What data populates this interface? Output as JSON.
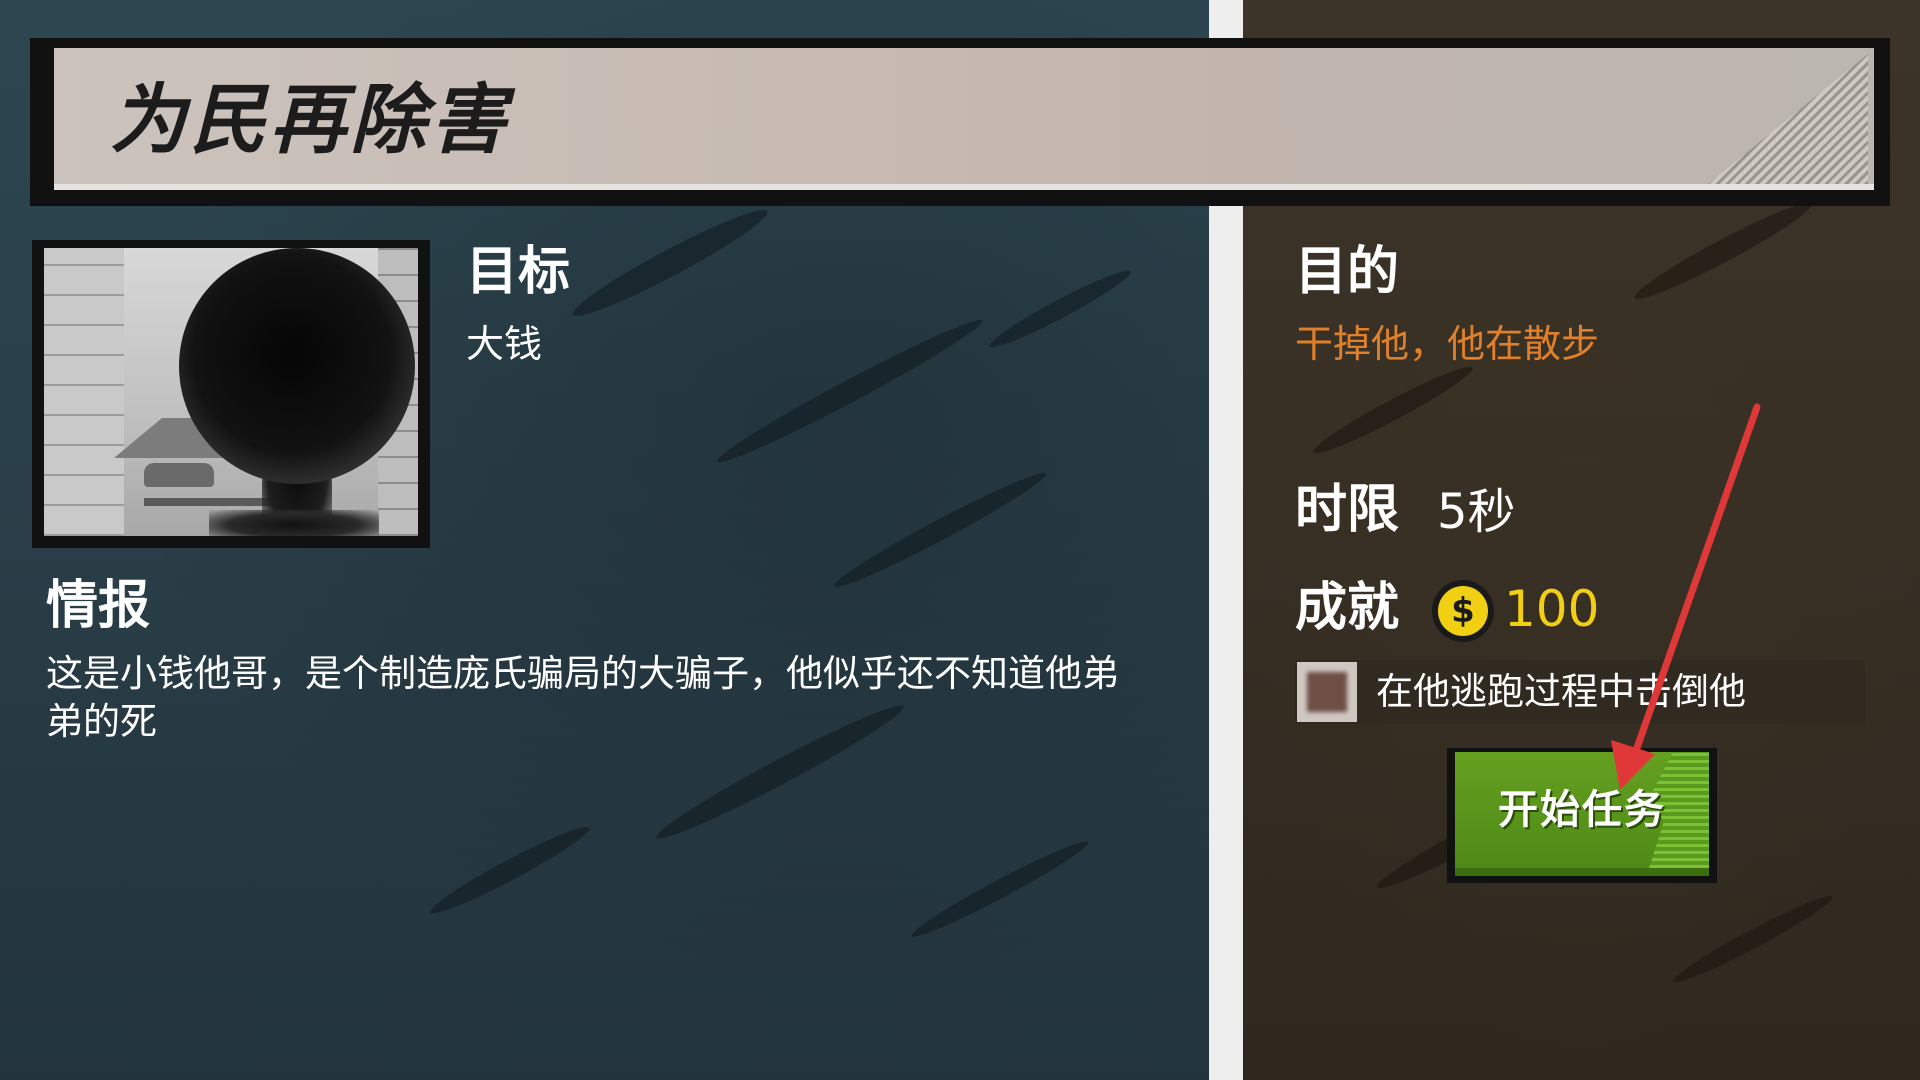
{
  "mission": {
    "title": "为民再除害"
  },
  "target": {
    "label": "目标",
    "name": "大钱"
  },
  "intel": {
    "label": "情报",
    "text": "这是小钱他哥，是个制造庞氏骗局的大骗子，他似乎还不知道他弟弟的死"
  },
  "objective": {
    "label": "目的",
    "text": "干掉他，他在散步"
  },
  "time_limit": {
    "label": "时限",
    "value": "5秒"
  },
  "achievement": {
    "label": "成就",
    "coin_symbol": "$",
    "reward": "100",
    "bonus_text": "在他逃跑过程中击倒他"
  },
  "start_button": {
    "label": "开始任务"
  },
  "colors": {
    "objective": "#e0802a",
    "coin": "#f1cf12",
    "button": "#5a9a1f",
    "arrow": "#e03838"
  }
}
